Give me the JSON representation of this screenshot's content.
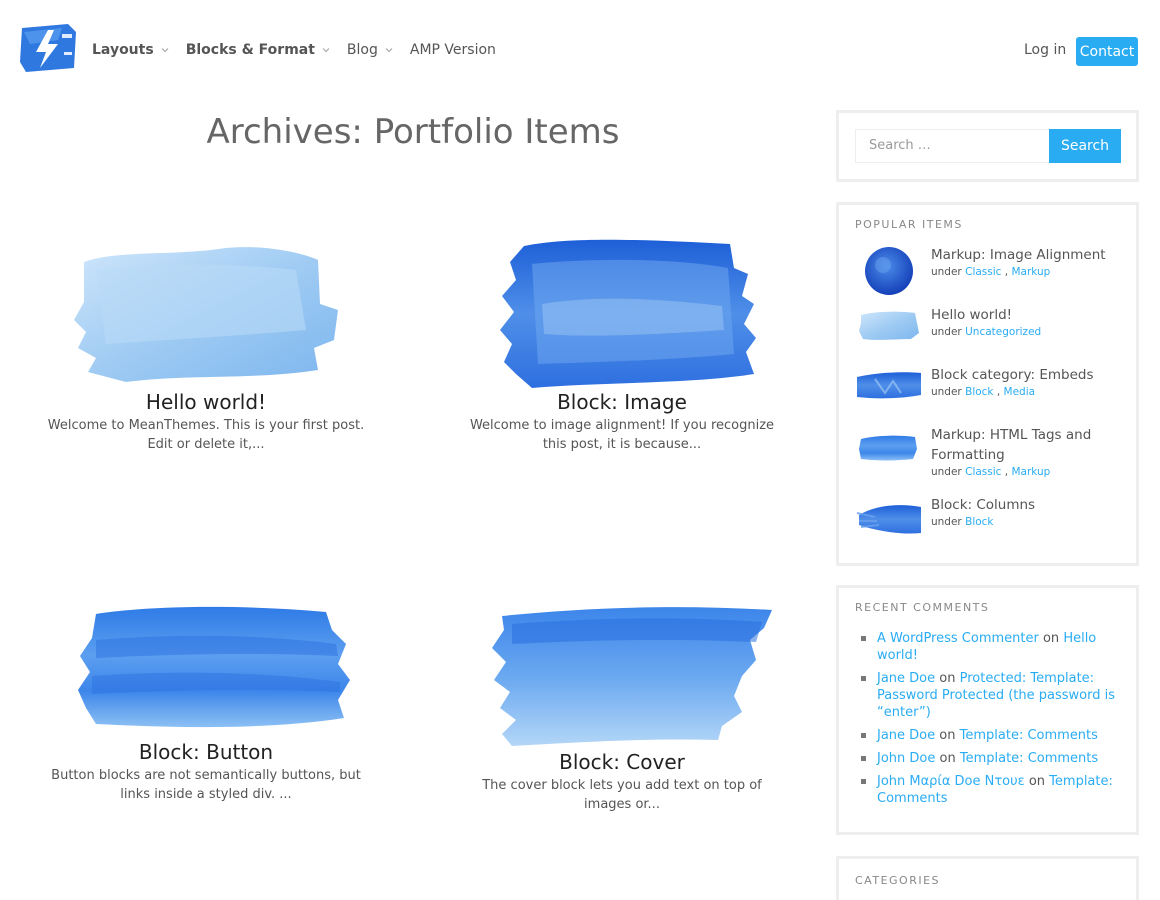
{
  "header": {
    "nav": [
      {
        "label": "Layouts",
        "bold": true,
        "dropdown": true
      },
      {
        "label": "Blocks & Format",
        "bold": true,
        "dropdown": true
      },
      {
        "label": "Blog",
        "bold": false,
        "dropdown": true
      },
      {
        "label": "AMP Version",
        "bold": false,
        "dropdown": false
      }
    ],
    "login_label": "Log in",
    "contact_label": "Contact"
  },
  "main": {
    "archive_title": "Archives: Portfolio Items",
    "posts": [
      {
        "title": "Hello world!",
        "excerpt": "Welcome to MeanThemes. This is your first post. Edit or delete it,..."
      },
      {
        "title": "Block: Image",
        "excerpt": "Welcome to image alignment! If you recognize this post, it is because..."
      },
      {
        "title": "Block: Button",
        "excerpt": "Button blocks are not semantically buttons, but links inside a styled div. ..."
      },
      {
        "title": "Block: Cover",
        "excerpt": "The cover block lets you add text on top of images or..."
      }
    ]
  },
  "sidebar": {
    "search": {
      "placeholder": "Search …",
      "button_label": "Search"
    },
    "popular": {
      "title": "POPULAR ITEMS",
      "items": [
        {
          "title": "Markup: Image Alignment",
          "under": "under",
          "cats": [
            "Classic",
            "Markup"
          ]
        },
        {
          "title": "Hello world!",
          "under": "under",
          "cats": [
            "Uncategorized"
          ]
        },
        {
          "title": "Block category: Embeds",
          "under": "under",
          "cats": [
            "Block",
            "Media"
          ]
        },
        {
          "title": "Markup: HTML Tags and Formatting",
          "under": "under",
          "cats": [
            "Classic",
            "Markup"
          ]
        },
        {
          "title": "Block: Columns",
          "under": "under",
          "cats": [
            "Block"
          ]
        }
      ]
    },
    "comments": {
      "title": "RECENT COMMENTS",
      "on": "on",
      "items": [
        {
          "author": "A WordPress Commenter",
          "post": "Hello world!"
        },
        {
          "author": "Jane Doe",
          "post": "Protected: Template: Password Protected (the password is “enter”)"
        },
        {
          "author": "Jane Doe",
          "post": "Template: Comments"
        },
        {
          "author": "John Doe",
          "post": "Template: Comments"
        },
        {
          "author": "John Μαρία Doe Ντουε",
          "post": "Template: Comments"
        }
      ]
    },
    "categories": {
      "title": "CATEGORIES"
    }
  },
  "colors": {
    "accent": "#2aacf3",
    "text": "#444444",
    "border": "#eeeeee"
  }
}
